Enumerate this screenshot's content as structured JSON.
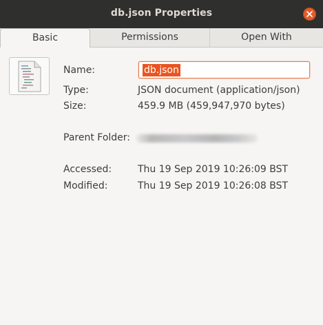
{
  "window": {
    "title": "db.json Properties",
    "accent_color": "#e95420",
    "close_icon": "close-icon"
  },
  "tabs": [
    {
      "label": "Basic",
      "active": true
    },
    {
      "label": "Permissions",
      "active": false
    },
    {
      "label": "Open With",
      "active": false
    }
  ],
  "basic": {
    "file_icon": "json-document-icon",
    "name_label": "Name:",
    "name_value": "db.json",
    "type_label": "Type:",
    "type_value": "JSON document (application/json)",
    "size_label": "Size:",
    "size_value": "459.9 MB (459,947,970 bytes)",
    "parent_folder_label": "Parent Folder:",
    "accessed_label": "Accessed:",
    "accessed_value": "Thu 19 Sep 2019 10:26:09 BST",
    "modified_label": "Modified:",
    "modified_value": "Thu 19 Sep 2019 10:26:08 BST"
  }
}
